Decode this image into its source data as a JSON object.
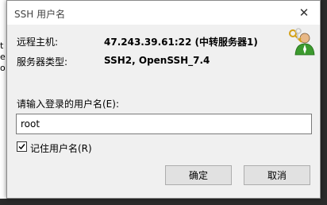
{
  "background_chars": [
    "t",
    "e",
    "o"
  ],
  "dialog": {
    "title": "SSH 用户名",
    "close_glyph": "✕",
    "host_label": "远程主机:",
    "host_value": "47.243.39.61:22 (中转服务器1)",
    "server_type_label": "服务器类型:",
    "server_type_value": "SSH2, OpenSSH_7.4",
    "icon": "server-keys-icon",
    "prompt": "请输入登录的用户名(E):",
    "username_value": "root",
    "remember_label": "记住用户名(R)",
    "remember_checked": true,
    "ok_label": "确定",
    "cancel_label": "取消"
  },
  "colors": {
    "dialog_bg": "#f0f0f0",
    "titlebar_bg": "#ffffff",
    "button_bg": "#e1e1e1",
    "button_border": "#adadad",
    "icon_green": "#3c9a2e",
    "icon_key_gold": "#d4a017"
  }
}
